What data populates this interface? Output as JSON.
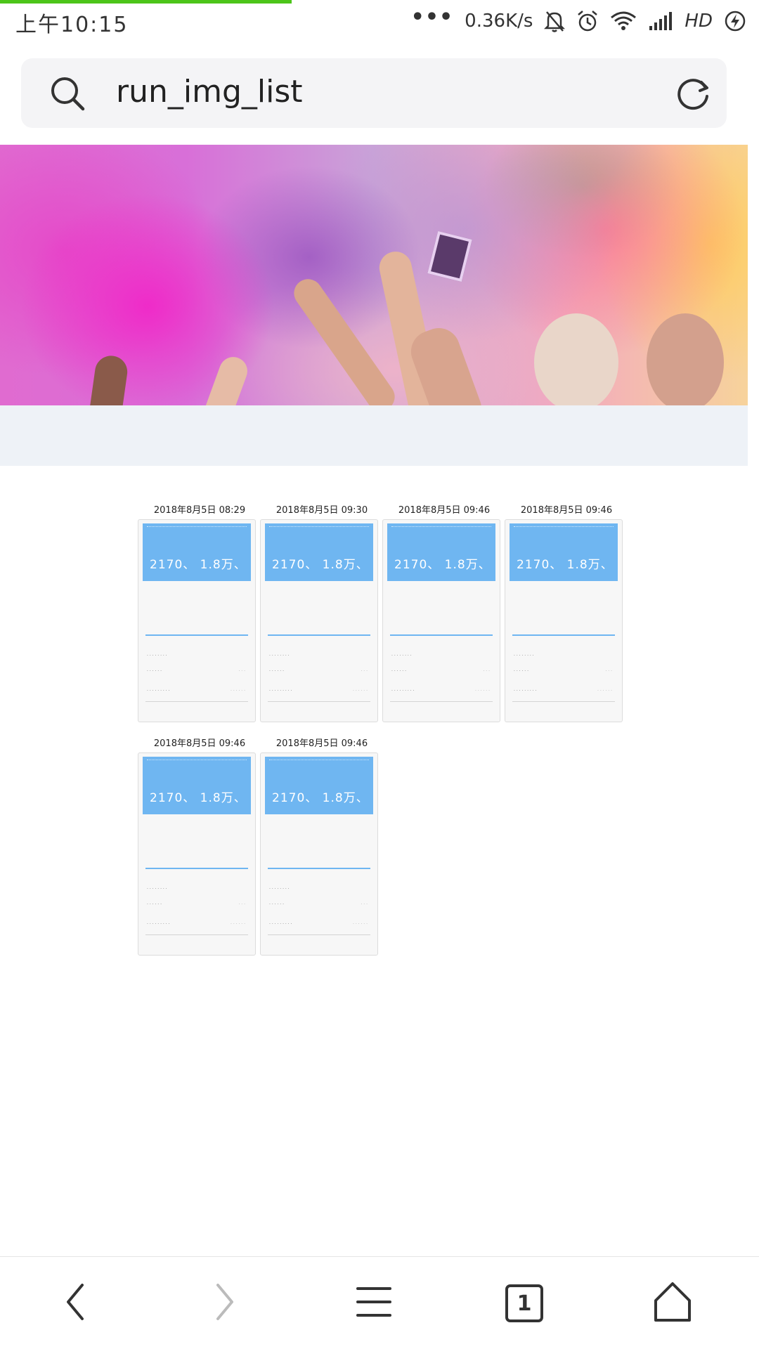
{
  "status_bar": {
    "time": "上午10:15",
    "more": "•••",
    "net_speed": "0.36K/s",
    "network": "HD",
    "icons": [
      "mute-bell-icon",
      "alarm-icon",
      "wifi-icon",
      "signal-icon",
      "charging-icon"
    ]
  },
  "address_bar": {
    "url": "run_img_list",
    "icons": [
      "search-icon",
      "refresh-icon"
    ]
  },
  "thumbnails": [
    {
      "date": "2018年8月5日 08:29",
      "stat": "2170、 1.8万、"
    },
    {
      "date": "2018年8月5日 09:30",
      "stat": "2170、 1.8万、"
    },
    {
      "date": "2018年8月5日 09:46",
      "stat": "2170、 1.8万、"
    },
    {
      "date": "2018年8月5日 09:46",
      "stat": "2170、 1.8万、"
    },
    {
      "date": "2018年8月5日 09:46",
      "stat": "2170、 1.8万、"
    },
    {
      "date": "2018年8月5日 09:46",
      "stat": "2170、 1.8万、"
    }
  ],
  "bottom_nav": {
    "tab_count": "1",
    "icons": [
      "back-icon",
      "forward-icon",
      "menu-icon",
      "tabs-icon",
      "home-icon"
    ]
  },
  "colors": {
    "progress": "#4cc51a",
    "card_header": "#6fb6f1",
    "grey_band": "#eef2f7"
  }
}
